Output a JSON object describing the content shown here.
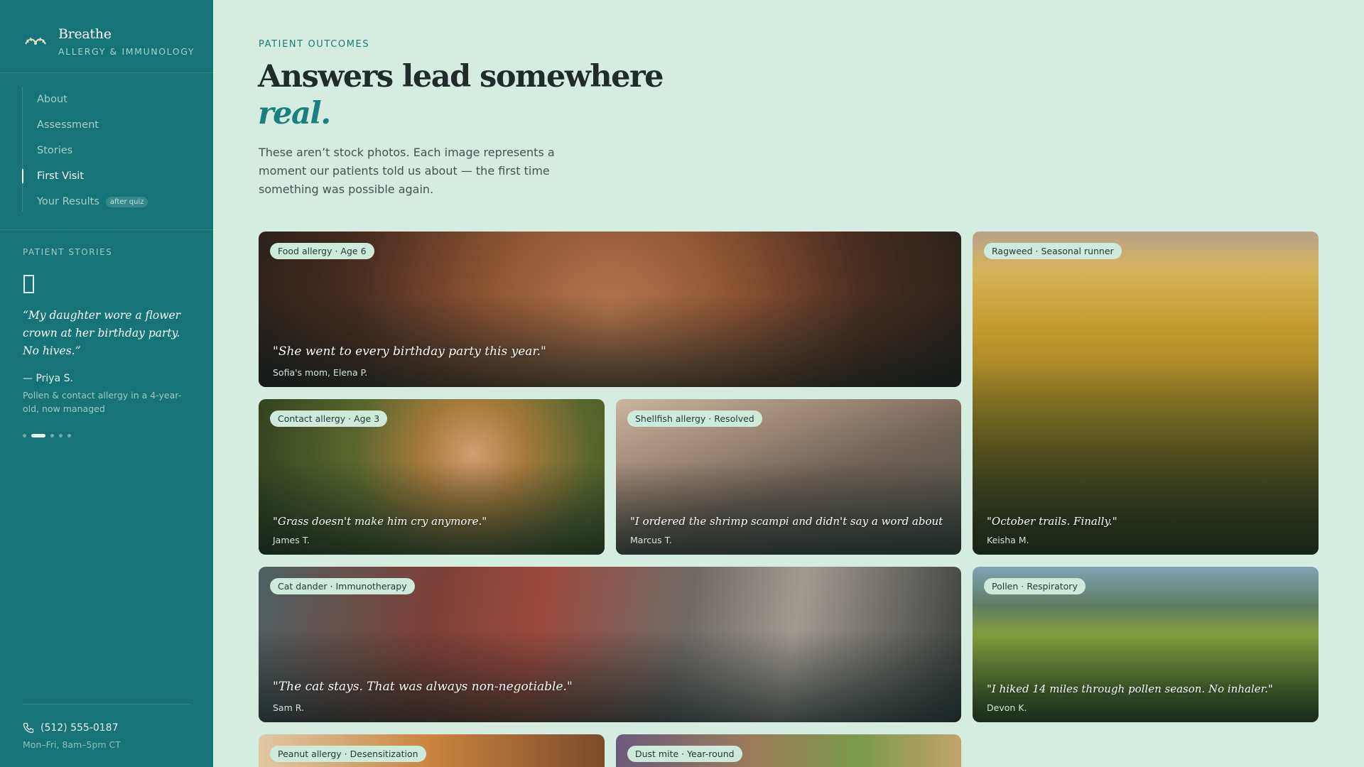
{
  "brand": {
    "name": "Breathe",
    "subtitle": "ALLERGY & IMMUNOLOGY"
  },
  "nav": {
    "items": [
      {
        "label": "About"
      },
      {
        "label": "Assessment"
      },
      {
        "label": "Stories"
      },
      {
        "label": "First Visit",
        "active": true
      },
      {
        "label": "Your Results",
        "badge": "after quiz"
      }
    ]
  },
  "sidebar_stories": {
    "label": "PATIENT STORIES",
    "quote": "“My daughter wore a flower crown at her birthday party. No hives.”",
    "author": "— Priya S.",
    "description": "Pollen & contact allergy in a 4-year-old, now managed",
    "dots_total": 5,
    "dots_active_index": 1
  },
  "contact": {
    "phone": "(512) 555-0187",
    "hours": "Mon–Fri, 8am–5pm CT"
  },
  "header": {
    "eyebrow": "PATIENT OUTCOMES",
    "title": "Answers lead somewhere",
    "title_accent": "real.",
    "intro": "These aren’t stock photos. Each image represents a moment our patients told us about — the first time something was possible again."
  },
  "cards": [
    {
      "tag": "Food allergy · Age 6",
      "quote": "\"She went to every birthday party this year.\"",
      "author": "Sofia's mom, Elena P."
    },
    {
      "tag": "Contact allergy · Age 3",
      "quote": "\"Grass doesn't make him cry anymore.\"",
      "author": "James T."
    },
    {
      "tag": "Shellfish allergy · Resolved",
      "quote": "\"I ordered the shrimp scampi and didn't say a word about it.\"",
      "author": "Marcus T."
    },
    {
      "tag": "Ragweed · Seasonal runner",
      "quote": "\"October trails. Finally.\"",
      "author": "Keisha M."
    },
    {
      "tag": "Cat dander · Immunotherapy",
      "quote": "\"The cat stays. That was always non-negotiable.\"",
      "author": "Sam R."
    },
    {
      "tag": "Pollen · Respiratory",
      "quote": "\"I hiked 14 miles through pollen season. No inhaler.\"",
      "author": "Devon K."
    },
    {
      "tag": "Peanut allergy · Desensitization"
    },
    {
      "tag": "Dust mite · Year-round"
    }
  ]
}
